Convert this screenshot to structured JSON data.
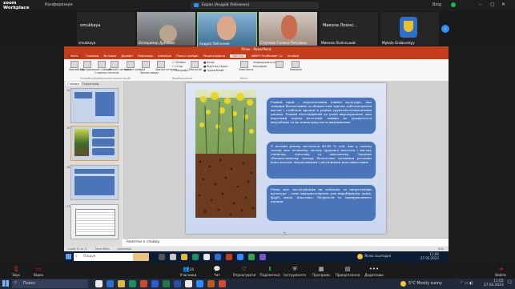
{
  "zoom": {
    "logo_line1": "zoom",
    "logo_line2": "Workplace",
    "conference_label": "Конференція",
    "share_banner": "Екран (Андрій Лебченко)",
    "exit_label": "Вхід",
    "participants": [
      {
        "name": "smukkaya",
        "big_name": "smukkaya"
      },
      {
        "name": "Володимир Дубовий",
        "big_name": ""
      },
      {
        "name": "Андрій Лебченко",
        "big_name": ""
      },
      {
        "name": "Стрілова Галина Петрівна",
        "big_name": ""
      },
      {
        "name": "Микола Лозінський",
        "big_name": "Микола Лозінс..."
      },
      {
        "name": "Mykola Grabovskyy",
        "big_name": ""
      }
    ],
    "controls": {
      "audio": "Звук",
      "video": "Відео",
      "participants": "Учасники",
      "participants_count": "24",
      "chat": "Чат",
      "react": "Отреагувати",
      "share": "Поділитися",
      "host_tools": "Інструменти",
      "apps": "Програми",
      "whiteboard": "Прикріплення",
      "more": "Додатково",
      "leave": "Вийти"
    }
  },
  "powerpoint": {
    "window_title": "Ріпак - PowerPoint",
    "tabs": [
      "Файл",
      "Головна",
      "Вставка",
      "Дизайн",
      "Переходи",
      "Анімація",
      "Показ слайдів",
      "Рецензування",
      "Вигляд",
      "ABBYY FineReader 12",
      "Acrobat"
    ],
    "ribbon": {
      "groups": [
        "Способи відображення презентацій",
        "Зразкові",
        "Відображення",
        "Масштаб",
        "Колір або відтінки сірого",
        "Вікно",
        "Макроси"
      ],
      "buttons": [
        "Звичайний",
        "Сортувальник слайдів",
        "Сторінки нотаток",
        "Режим читання",
        "Зразок слайдів",
        "Зразок видач",
        "Зразок нотаток",
        "Лінійка",
        "Сітка",
        "Напрямні",
        "Масштаб",
        "Припасувати до вікна",
        "Колір",
        "Відтінки сірого",
        "Чорно-білий",
        "Нове вікно",
        "Упорядкувати все",
        "Каскадом",
        "Переключення вікон",
        "Макроси"
      ]
    },
    "panel_tabs": [
      "Слайди",
      "Структура"
    ],
    "slide_numbers": [
      "14",
      "15",
      "16",
      "17"
    ],
    "slide_boxes": [
      "Ранній ярий – перспективна олійна культура, яка завдяки біологічним особливостям здатна забезпечувати високі і стабільні врожаї в різних ґрунтово-кліматичних умовах. Ранній вегетаційний до умов вирощування, має короткий період вегетації, майже не уражується хворобами та не пошкоджується шкідниками.",
      "У насінні ріпаку міститься 40-45 % олії, яка у своєму складі має незначну частку ерукової кислоти і високу олеїнову, лінолеву та ліноленову. Завдяки збалансованому складу біологічно активних речовин вона володіє лікувальними і дієтичними властивостями.",
      "Ріпак має застосування як технічна та енергетична культура – олію використовують для виробництва лаків, фарб, мила, пластмас, біодизеля та змащувального палива."
    ],
    "notes_placeholder": "Заметки к слайду",
    "status_left": "Слайд 15 из 17",
    "status_theme": "Тема Office",
    "status_lang": "українська",
    "zoom_level": "64%"
  },
  "remote_taskbar": {
    "search_placeholder": "Пошук",
    "weather": "Ясно сьогодні",
    "time": "11:04",
    "date": "27.02.2023"
  },
  "local_taskbar": {
    "search_placeholder": "Поиск",
    "weather": "5°C Mostly sunny",
    "time": "11:05",
    "date": "27.02.2023"
  },
  "colors": {
    "ppt_accent": "#c43e1c",
    "zoom_blue": "#2d8cff",
    "slide_box": "#4a76b9",
    "leave_red": "#e02828"
  }
}
